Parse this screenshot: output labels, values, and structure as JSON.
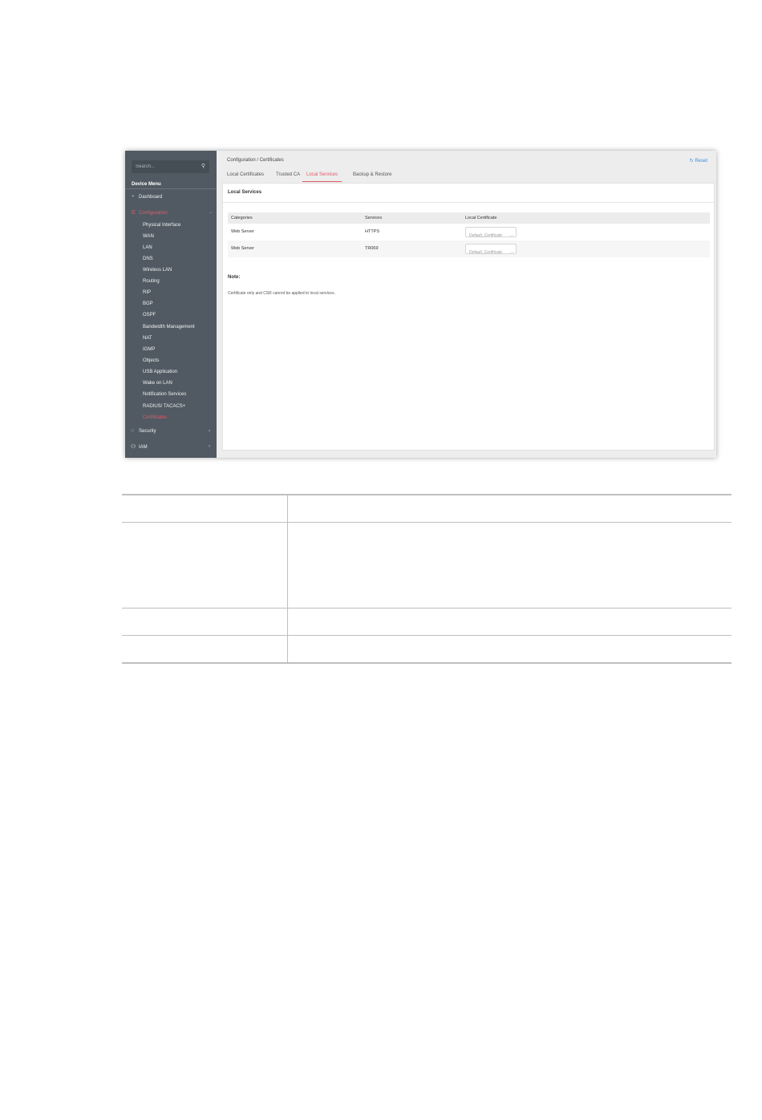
{
  "sidebar": {
    "search_placeholder": "Search...",
    "menu_title": "Device Menu",
    "dashboard_label": "Dashboard",
    "configuration_label": "Configuration",
    "config_items": [
      "Physical Interface",
      "WAN",
      "LAN",
      "DNS",
      "Wireless LAN",
      "Routing",
      "RIP",
      "BGP",
      "OSPF",
      "Bandwidth Management",
      "NAT",
      "IGMP",
      "Objects",
      "USB Application",
      "Wake on LAN",
      "Notification Services",
      "RADIUS/ TACACS+",
      "Certificates"
    ],
    "security_label": "Security",
    "iam_label": "IAM"
  },
  "header": {
    "breadcrumb": "Configuration / Certificates",
    "reset_label": "Reset"
  },
  "tabs": [
    "Local Certificates",
    "Trusted CA",
    "Local Services",
    "Backup & Restore"
  ],
  "active_tab": "Local Services",
  "panel": {
    "title": "Local Services",
    "columns": [
      "Categories",
      "Services",
      "Local Certificate"
    ],
    "rows": [
      {
        "category": "Web Server",
        "service": "HTTPS",
        "certificate": "Default_Certificate"
      },
      {
        "category": "Web Server",
        "service": "TR069",
        "certificate": "Default_Certificate"
      }
    ],
    "note_title": "Note:",
    "note_text": "Certificate only and CSR cannot be applied to local services."
  },
  "colors": {
    "accent": "#e05a6a",
    "link": "#3a8ee6",
    "sidebar_bg": "#515a62"
  }
}
